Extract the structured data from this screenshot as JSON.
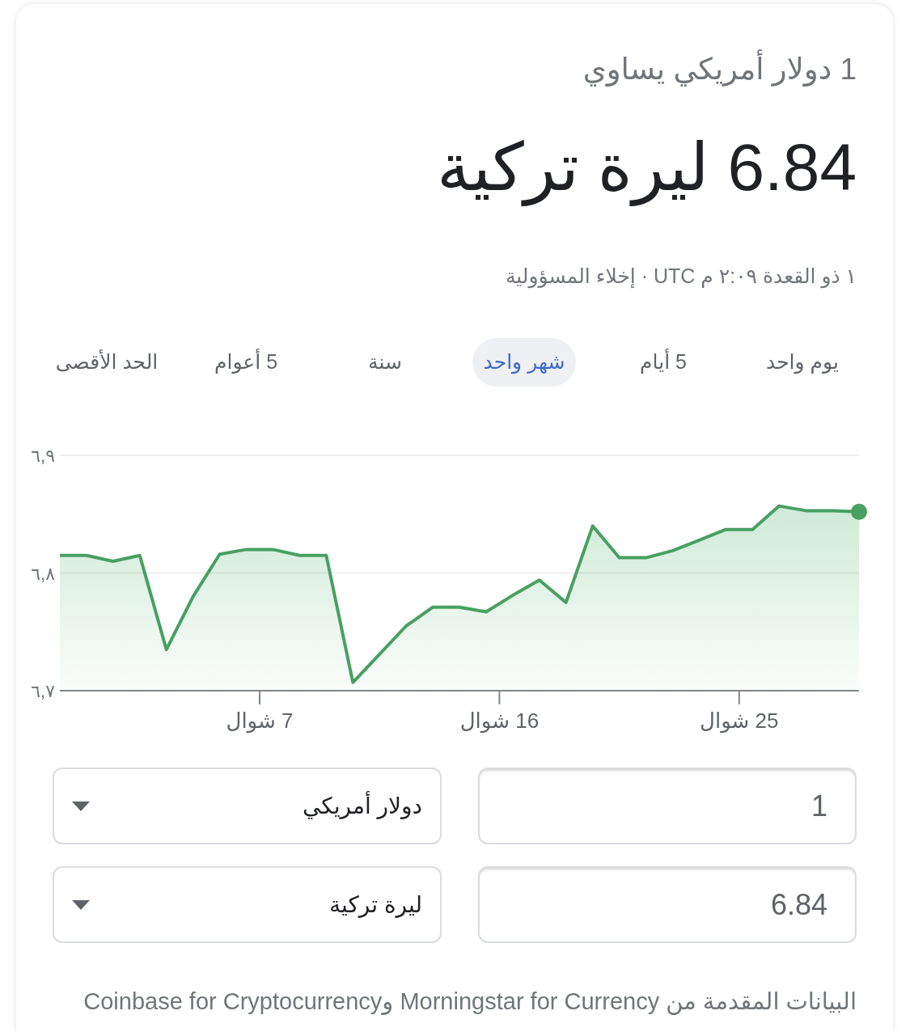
{
  "headline": "1 دولار أمريكي يساوي",
  "result": "6.84 ليرة تركية",
  "info_line": {
    "timestamp": "١ ذو القعدة ٢:٠٩ م UTC",
    "separator": "·",
    "disclaimer": "إخلاء المسؤولية"
  },
  "tabs": [
    {
      "label": "يوم واحد",
      "selected": false
    },
    {
      "label": "5 أيام",
      "selected": false
    },
    {
      "label": "شهر واحد",
      "selected": true
    },
    {
      "label": "سنة",
      "selected": false
    },
    {
      "label": "5 أعوام",
      "selected": false
    },
    {
      "label": "الحد الأقصى",
      "selected": false
    }
  ],
  "chart": {
    "chart_data": {
      "type": "area",
      "x": [
        -0.5,
        0.5,
        1.5,
        2.5,
        3.5,
        4.5,
        5.5,
        6.5,
        7.5,
        8.5,
        9.5,
        10.5,
        11.5,
        12.5,
        13.5,
        14.5,
        15.5,
        16.5,
        17.5,
        18.5,
        19.5,
        20.5,
        21.5,
        22.5,
        23.5,
        24.5,
        25.5,
        26.5,
        27.5,
        28.5,
        29.5
      ],
      "values": [
        6.815,
        6.815,
        6.81,
        6.815,
        6.735,
        6.78,
        6.816,
        6.82,
        6.82,
        6.815,
        6.815,
        6.707,
        6.731,
        6.755,
        6.771,
        6.771,
        6.767,
        6.781,
        6.794,
        6.775,
        6.84,
        6.813,
        6.813,
        6.819,
        6.828,
        6.837,
        6.837,
        6.857,
        6.853,
        6.853,
        6.852
      ],
      "xlim": [
        -0.5,
        29.5
      ],
      "ylim": [
        6.7,
        6.9
      ],
      "xticks": [
        {
          "value": 7,
          "label": "7 شوال"
        },
        {
          "value": 16,
          "label": "16 شوال"
        },
        {
          "value": 25,
          "label": "25 شوال"
        }
      ],
      "yticks": [
        {
          "value": 6.7,
          "label": "٦,٧"
        },
        {
          "value": 6.8,
          "label": "٦,٨"
        },
        {
          "value": 6.9,
          "label": "٦,٩"
        }
      ]
    }
  },
  "converter": [
    {
      "amount": "1",
      "currency": "دولار أمريكي"
    },
    {
      "amount": "6.84",
      "currency": "ليرة تركية"
    }
  ],
  "source_note": "البيانات المقدمة من Morningstar for Currency وCoinbase for Cryptocurrency"
}
